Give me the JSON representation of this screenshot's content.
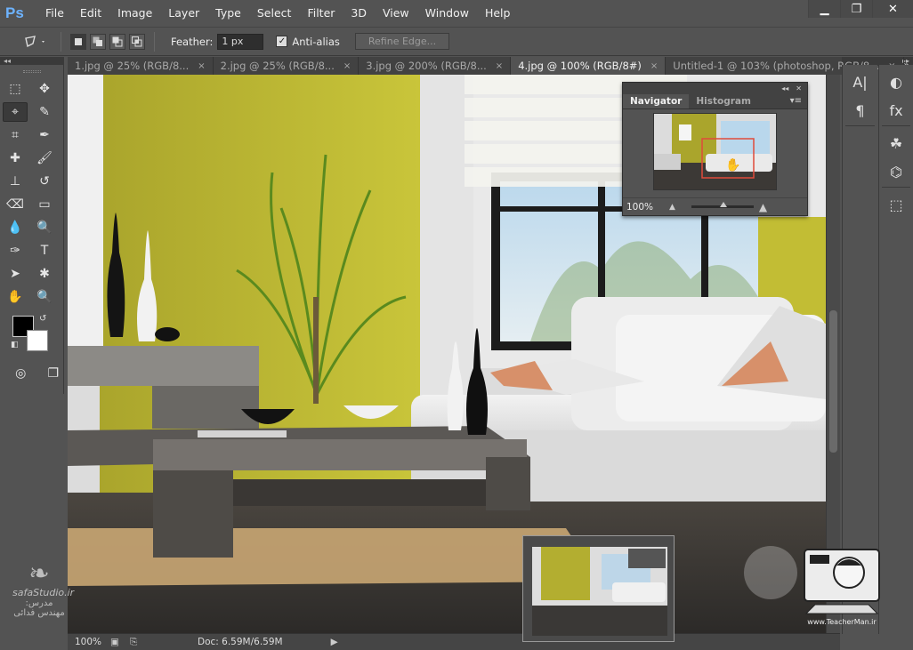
{
  "app": {
    "logo": "Ps",
    "menu": [
      "File",
      "Edit",
      "Image",
      "Layer",
      "Type",
      "Select",
      "Filter",
      "3D",
      "View",
      "Window",
      "Help"
    ],
    "window_buttons": {
      "minimize": "▁",
      "restore": "❐",
      "close": "✕"
    }
  },
  "options_bar": {
    "feather_label": "Feather:",
    "feather_value": "1 px",
    "antialias_label": "Anti-alias",
    "antialias_checked": true,
    "refine_edge_label": "Refine Edge..."
  },
  "tabs": [
    {
      "label": "1.jpg @ 25% (RGB/8...",
      "active": false
    },
    {
      "label": "2.jpg @ 25% (RGB/8...",
      "active": false
    },
    {
      "label": "3.jpg @ 200% (RGB/8...",
      "active": false
    },
    {
      "label": "4.jpg @ 100% (RGB/8#)",
      "active": true
    },
    {
      "label": "Untitled-1 @ 103% (photoshop, RGB/8...",
      "active": false
    }
  ],
  "tab_close_glyph": "×",
  "toolbox": {
    "tools": [
      {
        "name": "rectangular-marquee-icon",
        "glyph": "⬚"
      },
      {
        "name": "move-icon",
        "glyph": "✥"
      },
      {
        "name": "polygonal-lasso-icon",
        "glyph": "⌖",
        "selected": true
      },
      {
        "name": "quick-selection-icon",
        "glyph": "✎"
      },
      {
        "name": "crop-icon",
        "glyph": "⌗"
      },
      {
        "name": "eyedropper-icon",
        "glyph": "✒"
      },
      {
        "name": "spot-healing-icon",
        "glyph": "✚"
      },
      {
        "name": "brush-icon",
        "glyph": "🖌"
      },
      {
        "name": "clone-stamp-icon",
        "glyph": "⊥"
      },
      {
        "name": "history-brush-icon",
        "glyph": "↺"
      },
      {
        "name": "eraser-icon",
        "glyph": "⌫"
      },
      {
        "name": "gradient-icon",
        "glyph": "▭"
      },
      {
        "name": "blur-icon",
        "glyph": "💧"
      },
      {
        "name": "dodge-icon",
        "glyph": "🔍"
      },
      {
        "name": "pen-icon",
        "glyph": "✑"
      },
      {
        "name": "type-icon",
        "glyph": "T"
      },
      {
        "name": "path-selection-icon",
        "glyph": "➤"
      },
      {
        "name": "custom-shape-icon",
        "glyph": "✱"
      },
      {
        "name": "hand-icon",
        "glyph": "✋"
      },
      {
        "name": "zoom-icon",
        "glyph": "🔍"
      }
    ]
  },
  "navigator": {
    "tab_navigator": "Navigator",
    "tab_histogram": "Histogram",
    "zoom": "100%"
  },
  "status": {
    "zoom": "100%",
    "doc": "Doc: 6.59M/6.59M"
  },
  "watermark": {
    "site": "safaStudio.ir",
    "teacher_site": "www.TeacherMan.ir",
    "persian_line": "مدرس: مهندس فدائی"
  },
  "colors": {
    "ui_bg": "#535353",
    "accent_ps_logo": "#6db3ff",
    "foreground": "#000000",
    "background": "#ffffff",
    "wall_yellow": "#b8b733"
  }
}
